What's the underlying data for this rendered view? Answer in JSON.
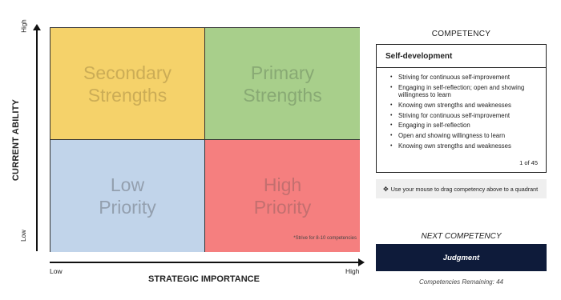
{
  "matrix": {
    "y_axis": {
      "title": "CURRENT ABILITY",
      "high": "High",
      "low": "Low"
    },
    "x_axis": {
      "title": "STRATEGIC IMPORTANCE",
      "low": "Low",
      "high": "High"
    },
    "quadrants": {
      "secondary": {
        "label": "Secondary\nStrengths",
        "color": "#f5d26a"
      },
      "primary": {
        "label": "Primary\nStrengths",
        "color": "#a8cf8b"
      },
      "low_priority": {
        "label": "Low\nPriority",
        "color": "#c1d4ea"
      },
      "high_priority": {
        "label": "High\nPriority",
        "color": "#f57f7f"
      }
    },
    "note": "*Strive for 8-10 competencies"
  },
  "competency_panel": {
    "heading": "COMPETENCY",
    "card": {
      "title": "Self-development",
      "items": [
        "Striving for continuous self-improvement",
        "Engaging in self-reflection; open and showing willingness to learn",
        "Knowing own strengths and weaknesses",
        "Striving for continuous self-improvement",
        "Engaging in self-reflection",
        "Open and showing willingness to learn",
        "Knowing own strengths and weaknesses"
      ],
      "counter": "1 of 45"
    },
    "hint": {
      "icon": "move-icon",
      "text": "Use your mouse to drag competency above to a quadrant"
    },
    "next_heading": "NEXT COMPETENCY",
    "next_button": "Judgment",
    "remaining": "Competencies Remaining: 44",
    "accent_color": "#0e1b3a"
  }
}
